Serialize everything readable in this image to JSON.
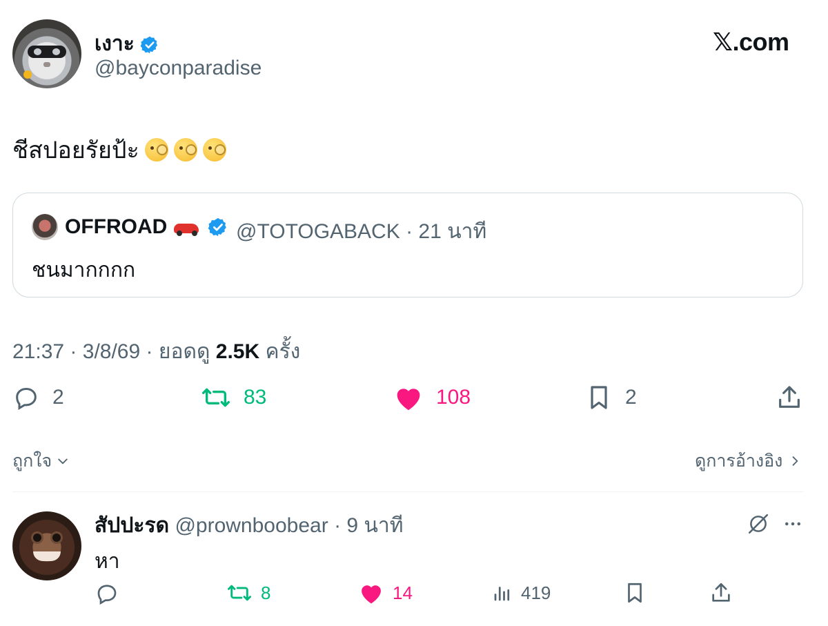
{
  "author": {
    "display_name": "เงาะ",
    "handle": "@bayconparadise",
    "verified": true
  },
  "brand": {
    "site_label": "𝕏.com"
  },
  "tweet": {
    "text": "ชีสปอยรัยป้ะ",
    "emoji": [
      "face-with-monocle",
      "face-with-monocle",
      "face-with-monocle"
    ]
  },
  "quote": {
    "display_name": "OFFROAD",
    "emoji": "red-car",
    "handle": "@TOTOGABACK",
    "separator": "·",
    "time": "21 นาที",
    "text": "ชนมากกกก"
  },
  "meta": {
    "time": "21:37",
    "date": "3/8/69",
    "views_label": "ยอดดู",
    "views": "2.5K",
    "views_suffix": "ครั้ง",
    "sep": "·"
  },
  "actions": {
    "replies": "2",
    "reposts": "83",
    "likes": "108",
    "bookmarks": "2"
  },
  "filters": {
    "likes_filter": "ถูกใจ",
    "see_quotes": "ดูการอ้างอิง"
  },
  "reply": {
    "display_name": "สัปปะรด",
    "handle": "@prownboobear",
    "sep": "·",
    "time": "9 นาที",
    "text": "หา",
    "reposts": "8",
    "likes": "14",
    "views": "419"
  },
  "colors": {
    "verified": "#1d9bf0",
    "repost": "#00ba7c",
    "like": "#f91880",
    "muted": "#536471"
  }
}
